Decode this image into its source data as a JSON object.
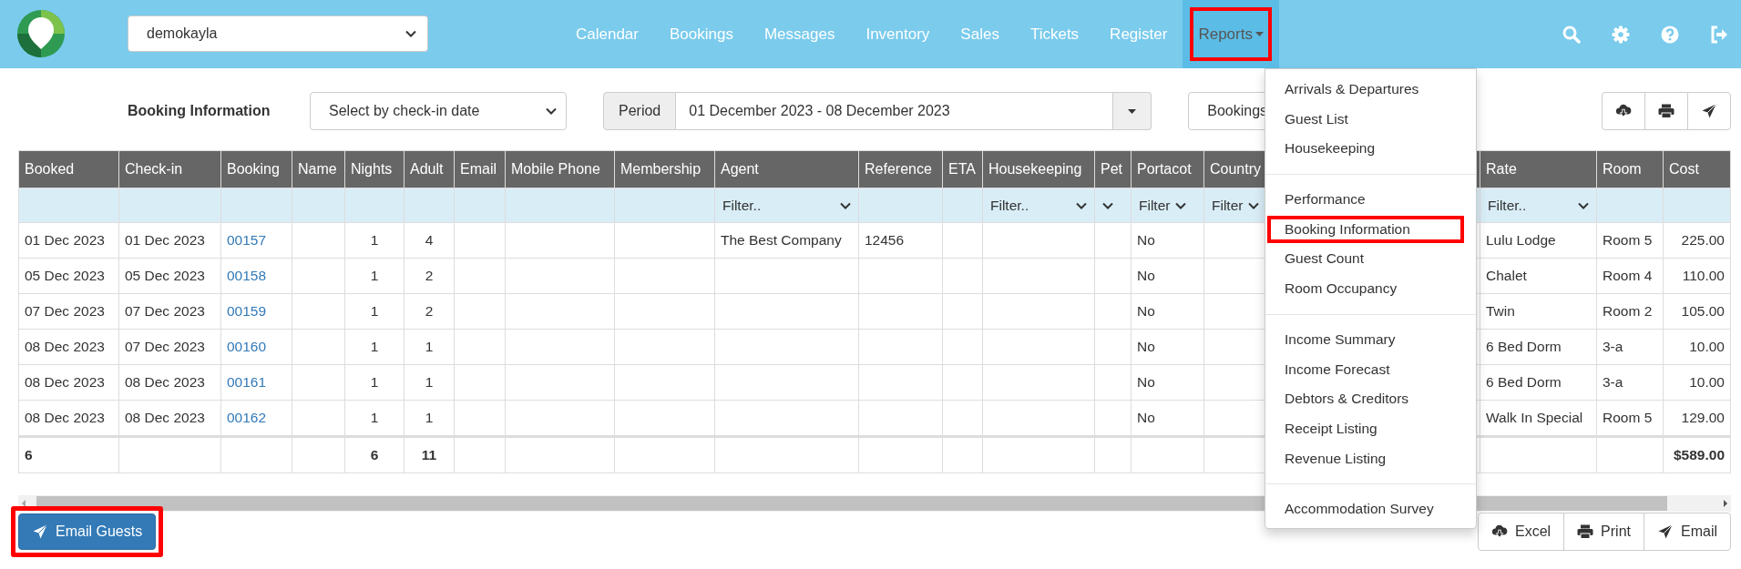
{
  "header": {
    "account": "demokayla",
    "nav": [
      {
        "label": "Calendar",
        "selected": false,
        "highlighted": false
      },
      {
        "label": "Bookings",
        "selected": false,
        "highlighted": false
      },
      {
        "label": "Messages",
        "selected": false,
        "highlighted": false
      },
      {
        "label": "Inventory",
        "selected": false,
        "highlighted": false
      },
      {
        "label": "Sales",
        "selected": false,
        "highlighted": false
      },
      {
        "label": "Tickets",
        "selected": false,
        "highlighted": false
      },
      {
        "label": "Register",
        "selected": false,
        "highlighted": false
      },
      {
        "label": "Reports",
        "selected": true,
        "highlighted": true
      }
    ]
  },
  "toolbar": {
    "title": "Booking Information",
    "date_mode": "Select by check-in date",
    "period_label": "Period",
    "period_value": "01 December 2023 - 08 December 2023",
    "view_select": "Bookings",
    "export_buttons": [
      {
        "kind": "excel"
      },
      {
        "kind": "print"
      },
      {
        "kind": "email"
      }
    ]
  },
  "reports_menu": {
    "groups": [
      [
        {
          "label": "Arrivals & Departures",
          "highlighted": false
        },
        {
          "label": "Guest List",
          "highlighted": false
        },
        {
          "label": "Housekeeping",
          "highlighted": false
        }
      ],
      [
        {
          "label": "Performance",
          "highlighted": false
        },
        {
          "label": "Booking Information",
          "highlighted": true
        },
        {
          "label": "Guest Count",
          "highlighted": false
        },
        {
          "label": "Room Occupancy",
          "highlighted": false
        }
      ],
      [
        {
          "label": "Income Summary",
          "highlighted": false
        },
        {
          "label": "Income Forecast",
          "highlighted": false
        },
        {
          "label": "Debtors & Creditors",
          "highlighted": false
        },
        {
          "label": "Receipt Listing",
          "highlighted": false
        },
        {
          "label": "Revenue Listing",
          "highlighted": false
        }
      ],
      [
        {
          "label": "Accommodation Survey",
          "highlighted": false
        }
      ]
    ]
  },
  "table": {
    "columns": [
      {
        "label": "Booked",
        "kind": "text"
      },
      {
        "label": "Check-in",
        "kind": "text"
      },
      {
        "label": "Booking",
        "kind": "link"
      },
      {
        "label": "Name",
        "kind": "text"
      },
      {
        "label": "Nights",
        "kind": "count"
      },
      {
        "label": "Adult",
        "kind": "count"
      },
      {
        "label": "Email",
        "kind": "text"
      },
      {
        "label": "Mobile Phone",
        "kind": "text"
      },
      {
        "label": "Membership",
        "kind": "text"
      },
      {
        "label": "Agent",
        "kind": "text",
        "filter": {
          "kind": "select",
          "text": "Filter.."
        }
      },
      {
        "label": "Reference",
        "kind": "text"
      },
      {
        "label": "ETA",
        "kind": "text"
      },
      {
        "label": "Housekeeping",
        "kind": "text",
        "filter": {
          "kind": "select",
          "text": "Filter.."
        }
      },
      {
        "label": "Pet",
        "kind": "text",
        "filter": {
          "kind": "arrow_only"
        }
      },
      {
        "label": "Portacot",
        "kind": "text",
        "filter": {
          "kind": "select",
          "text": "Filter"
        }
      },
      {
        "label": "Country",
        "kind": "text",
        "filter": {
          "kind": "select",
          "text": "Filter"
        }
      },
      {
        "label": "Rate",
        "kind": "text",
        "filter": {
          "kind": "select",
          "text": "Filter.."
        }
      },
      {
        "label": "Room",
        "kind": "text"
      },
      {
        "label": "Cost",
        "kind": "money"
      }
    ],
    "rows": [
      {
        "booked": "01 Dec 2023",
        "check_in": "01 Dec 2023",
        "booking": "00157",
        "nights": "1",
        "adult": "4",
        "agent": "The Best Company",
        "reference": "12456",
        "portacot": "No",
        "rate": "Lulu Lodge",
        "room": "Room 5",
        "cost": "225.00"
      },
      {
        "booked": "05 Dec 2023",
        "check_in": "05 Dec 2023",
        "booking": "00158",
        "nights": "1",
        "adult": "2",
        "portacot": "No",
        "rate": "Chalet",
        "room": "Room 4",
        "cost": "110.00"
      },
      {
        "booked": "07 Dec 2023",
        "check_in": "07 Dec 2023",
        "booking": "00159",
        "nights": "1",
        "adult": "2",
        "portacot": "No",
        "rate": "Twin",
        "room": "Room 2",
        "cost": "105.00"
      },
      {
        "booked": "08 Dec 2023",
        "check_in": "07 Dec 2023",
        "booking": "00160",
        "nights": "1",
        "adult": "1",
        "portacot": "No",
        "rate": "6 Bed Dorm",
        "room": "3-a",
        "cost": "10.00"
      },
      {
        "booked": "08 Dec 2023",
        "check_in": "08 Dec 2023",
        "booking": "00161",
        "nights": "1",
        "adult": "1",
        "portacot": "No",
        "rate": "6 Bed Dorm",
        "room": "3-a",
        "cost": "10.00"
      },
      {
        "booked": "08 Dec 2023",
        "check_in": "08 Dec 2023",
        "booking": "00162",
        "nights": "1",
        "adult": "1",
        "portacot": "No",
        "rate": "Walk In Special",
        "room": "Room 5",
        "cost": "129.00"
      }
    ],
    "totals": {
      "booked": "6",
      "nights": "6",
      "adult": "11",
      "cost": "$589.00"
    }
  },
  "actions": {
    "email_guests": {
      "label": "Email Guests",
      "highlighted": true
    },
    "exports": [
      {
        "kind": "excel",
        "label": "Excel"
      },
      {
        "kind": "print",
        "label": "Print"
      },
      {
        "kind": "email",
        "label": "Email"
      }
    ]
  }
}
